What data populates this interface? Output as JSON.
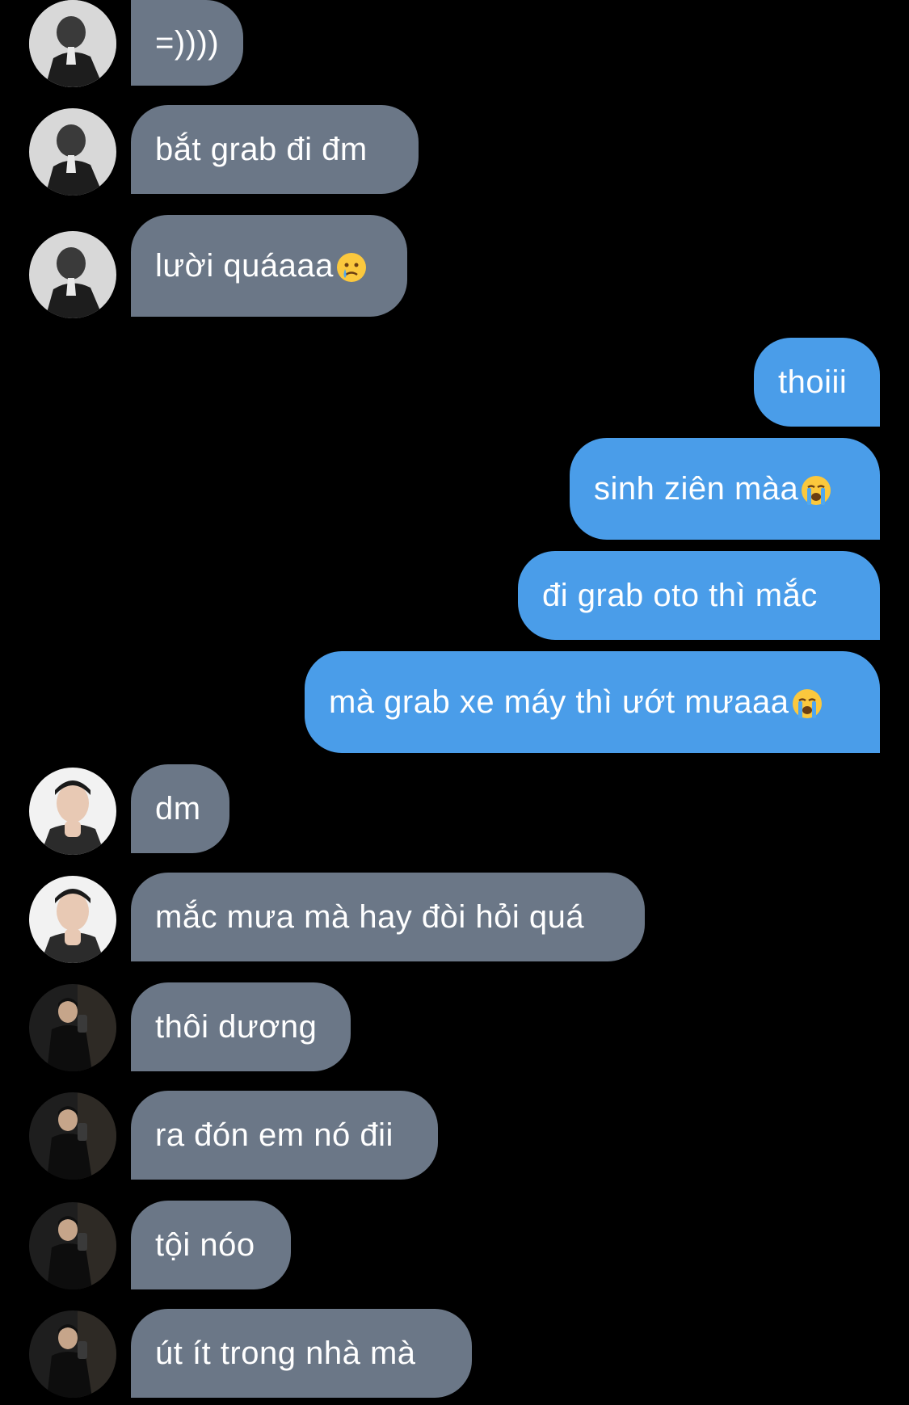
{
  "conversation": {
    "messages": [
      {
        "text": "=))))",
        "emoji": ""
      },
      {
        "text": "bắt grab đi đm",
        "emoji": ""
      },
      {
        "text": "lười quáaaa",
        "emoji": "crying-face"
      },
      {
        "text": "thoiii",
        "emoji": ""
      },
      {
        "text": "sinh ziên màa",
        "emoji": "loudly-crying-face"
      },
      {
        "text": "đi grab oto thì mắc",
        "emoji": ""
      },
      {
        "text": "mà grab xe máy thì ướt mưaaa",
        "emoji": "loudly-crying-face"
      },
      {
        "text": "dm",
        "emoji": ""
      },
      {
        "text": "mắc mưa mà hay đòi hỏi quá",
        "emoji": ""
      },
      {
        "text": "thôi dương",
        "emoji": ""
      },
      {
        "text": "ra đón em nó đii",
        "emoji": ""
      },
      {
        "text": "tội nóo",
        "emoji": ""
      },
      {
        "text": "út ít trong nhà mà",
        "emoji": ""
      }
    ]
  },
  "colors": {
    "background": "#000000",
    "incoming_bubble": "#6b7787",
    "outgoing_bubble": "#4a9de9",
    "text": "#ffffff"
  }
}
